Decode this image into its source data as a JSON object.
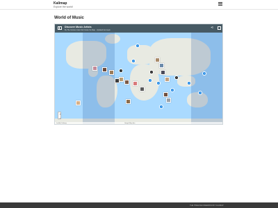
{
  "header": {
    "brand_title": "Kalimap",
    "brand_tagline": "Explore the world!",
    "menu_icon": "hamburger-menu-icon"
  },
  "page": {
    "title": "World of Music"
  },
  "map": {
    "title": "Discover Music Artists",
    "subtitle": "By The Curious Cats Club Inside the Map · Updated last week",
    "layers_icon": "layers-icon",
    "share_icon": "share-icon",
    "fullscreen_icon": "fullscreen-icon",
    "zoom_in_label": "+",
    "zoom_out_label": "−",
    "attribution": "Leaflet | Kalimap",
    "credits": "Google  Map data",
    "note_glyph": "♪",
    "ocean_color": "#aadaff",
    "land_color": "#e8eae2"
  },
  "footer": {
    "text": "THE TIMELINE FREEMIUM BY KALIMAP"
  }
}
